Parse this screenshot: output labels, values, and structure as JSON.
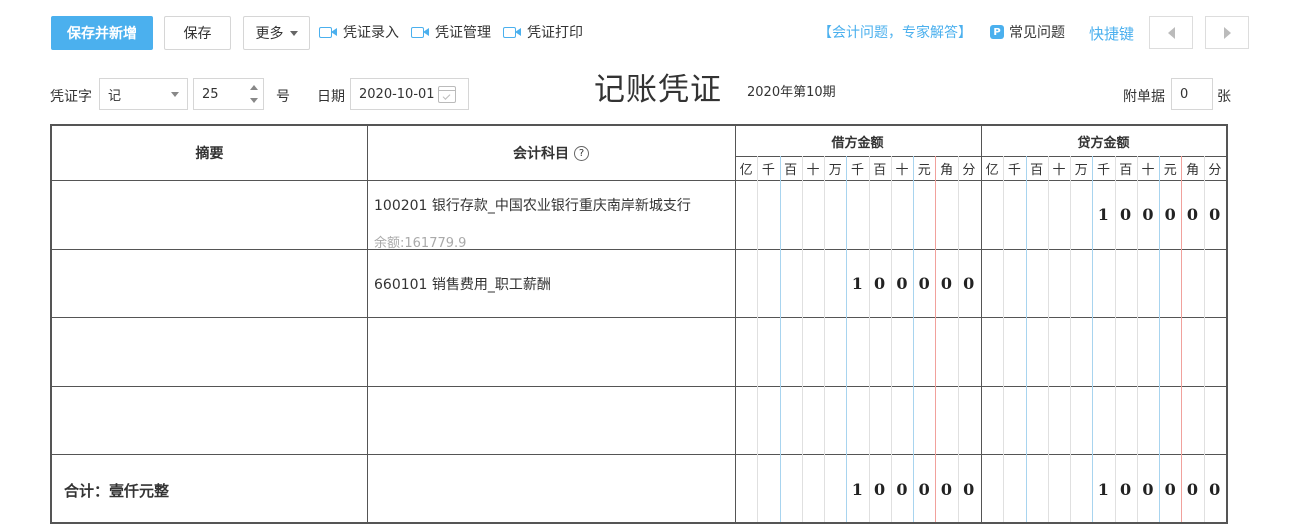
{
  "toolbar": {
    "save_new_label": "保存并新增",
    "save_label": "保存",
    "more_label": "更多",
    "links": [
      "凭证录入",
      "凭证管理",
      "凭证打印"
    ],
    "expert_link": "【会计问题，专家解答】",
    "faq_icon": "P",
    "faq_label": "常见问题",
    "shortcut_label": "快捷键"
  },
  "header": {
    "voucher_word_label": "凭证字",
    "voucher_word_value": "记",
    "number_value": "25",
    "number_suffix": "号",
    "date_label": "日期",
    "date_value": "2020-10-01",
    "title": "记账凭证",
    "period": "2020年第10期",
    "attach_label": "附单据",
    "attach_value": "0",
    "attach_suffix": "张"
  },
  "table": {
    "col_summary": "摘要",
    "col_account": "会计科目",
    "help_icon": "?",
    "col_debit": "借方金额",
    "col_credit": "贷方金额",
    "digit_units": [
      "亿",
      "千",
      "百",
      "十",
      "万",
      "千",
      "百",
      "十",
      "元",
      "角",
      "分"
    ],
    "rows": [
      {
        "summary": "",
        "account": "100201 银行存款_中国农业银行重庆南岸新城支行",
        "balance": "余额:161779.9",
        "debit": [
          "",
          "",
          "",
          "",
          "",
          "",
          "",
          "",
          "",
          "",
          ""
        ],
        "credit": [
          "",
          "",
          "",
          "",
          "",
          "1",
          "0",
          "0",
          "0",
          "0",
          "0"
        ]
      },
      {
        "summary": "",
        "account": "660101 销售费用_职工薪酬",
        "balance": "",
        "debit": [
          "",
          "",
          "",
          "",
          "",
          "1",
          "0",
          "0",
          "0",
          "0",
          "0"
        ],
        "credit": [
          "",
          "",
          "",
          "",
          "",
          "",
          "",
          "",
          "",
          "",
          ""
        ]
      },
      {
        "summary": "",
        "account": "",
        "balance": "",
        "debit": [
          "",
          "",
          "",
          "",
          "",
          "",
          "",
          "",
          "",
          "",
          ""
        ],
        "credit": [
          "",
          "",
          "",
          "",
          "",
          "",
          "",
          "",
          "",
          "",
          ""
        ]
      },
      {
        "summary": "",
        "account": "",
        "balance": "",
        "debit": [
          "",
          "",
          "",
          "",
          "",
          "",
          "",
          "",
          "",
          "",
          ""
        ],
        "credit": [
          "",
          "",
          "",
          "",
          "",
          "",
          "",
          "",
          "",
          "",
          ""
        ]
      }
    ],
    "total_label": "合计：壹仟元整",
    "total_debit": [
      "",
      "",
      "",
      "",
      "",
      "1",
      "0",
      "0",
      "0",
      "0",
      "0"
    ],
    "total_credit": [
      "",
      "",
      "",
      "",
      "",
      "1",
      "0",
      "0",
      "0",
      "0",
      "0"
    ]
  },
  "colors": {
    "primary": "#4bb0ee",
    "grid_blue": "#a8d4ef",
    "grid_red": "#f1a19c",
    "border": "#555555"
  }
}
